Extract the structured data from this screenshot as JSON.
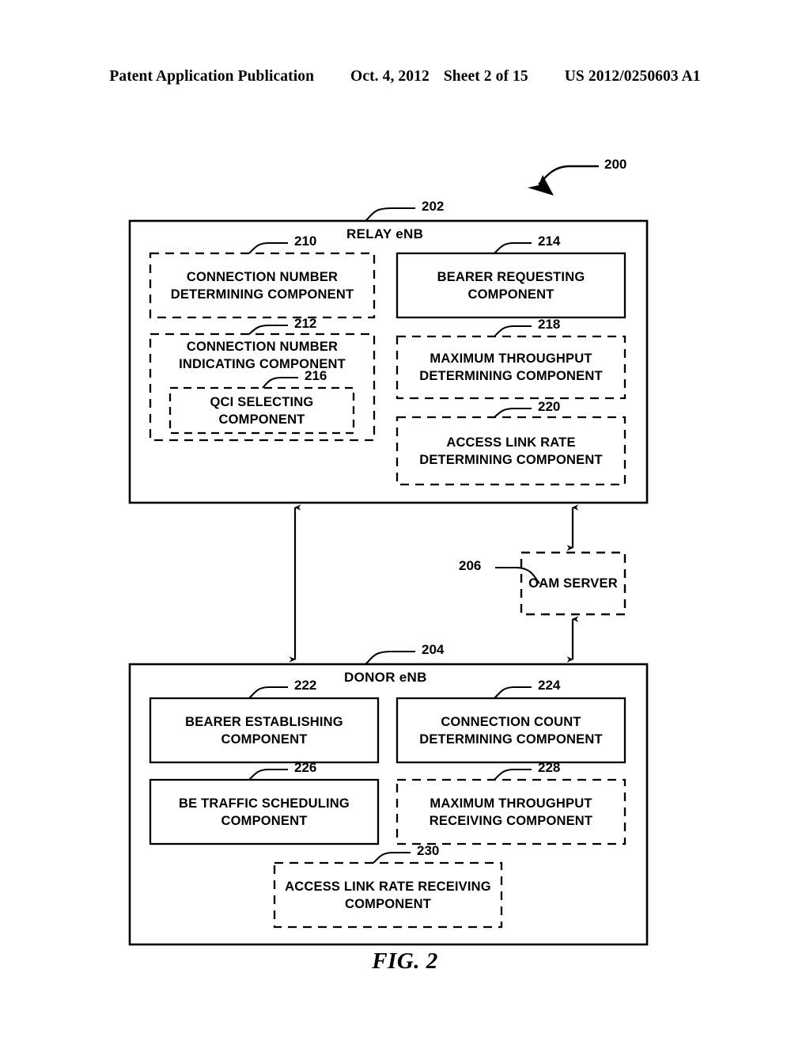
{
  "header": {
    "title": "Patent Application Publication",
    "date": "Oct. 4, 2012",
    "sheet": "Sheet 2 of 15",
    "pub_number": "US 2012/0250603 A1"
  },
  "figure": {
    "caption": "FIG. 2",
    "diagram_ref": "200"
  },
  "relay": {
    "ref": "202",
    "title": "RELAY eNB",
    "components": [
      {
        "ref": "210",
        "line1": "CONNECTION NUMBER",
        "line2": "DETERMINING COMPONENT",
        "style": "dashed"
      },
      {
        "ref": "214",
        "line1": "BEARER REQUESTING",
        "line2": "COMPONENT",
        "style": "solid"
      },
      {
        "ref": "212",
        "line1": "CONNECTION NUMBER",
        "line2": "INDICATING COMPONENT",
        "style": "dashed"
      },
      {
        "ref": "216",
        "line1": "QCI SELECTING",
        "line2": "COMPONENT",
        "style": "dashed"
      },
      {
        "ref": "218",
        "line1": "MAXIMUM THROUGHPUT",
        "line2": "DETERMINING COMPONENT",
        "style": "dashed"
      },
      {
        "ref": "220",
        "line1": "ACCESS LINK RATE",
        "line2": "DETERMINING COMPONENT",
        "style": "dashed"
      }
    ]
  },
  "oam": {
    "ref": "206",
    "label": "OAM SERVER",
    "style": "dashed"
  },
  "donor": {
    "ref": "204",
    "title": "DONOR eNB",
    "components": [
      {
        "ref": "222",
        "line1": "BEARER ESTABLISHING",
        "line2": "COMPONENT",
        "style": "solid"
      },
      {
        "ref": "224",
        "line1": "CONNECTION COUNT",
        "line2": "DETERMINING COMPONENT",
        "style": "solid"
      },
      {
        "ref": "226",
        "line1": "BE TRAFFIC SCHEDULING",
        "line2": "COMPONENT",
        "style": "solid"
      },
      {
        "ref": "228",
        "line1": "MAXIMUM THROUGHPUT",
        "line2": "RECEIVING COMPONENT",
        "style": "dashed"
      },
      {
        "ref": "230",
        "line1": "ACCESS LINK RATE RECEIVING",
        "line2": "COMPONENT",
        "style": "dashed"
      }
    ]
  },
  "connectors": [
    {
      "name": "relay-donor-link",
      "type": "double-arrow"
    },
    {
      "name": "relay-oam-link",
      "type": "double-arrow"
    },
    {
      "name": "oam-donor-link",
      "type": "double-arrow"
    }
  ],
  "colors": {
    "ink": "#000000",
    "background": "#ffffff"
  }
}
